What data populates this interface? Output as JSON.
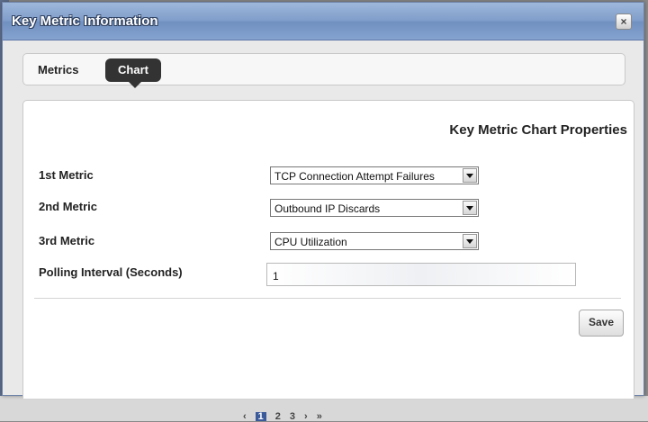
{
  "dialog": {
    "title": "Key Metric Information",
    "close_label": "×"
  },
  "tabs": [
    {
      "label": "Metrics",
      "active": false
    },
    {
      "label": "Chart",
      "active": true
    }
  ],
  "panel": {
    "heading": "Key Metric Chart Properties",
    "fields": {
      "metric1": {
        "label": "1st Metric",
        "value": "TCP Connection Attempt Failures"
      },
      "metric2": {
        "label": "2nd Metric",
        "value": "Outbound IP Discards"
      },
      "metric3": {
        "label": "3rd Metric",
        "value": "CPU Utilization"
      },
      "polling": {
        "label": "Polling Interval (Seconds)",
        "value": "1"
      }
    },
    "save_label": "Save"
  },
  "pager": {
    "current_page": "1",
    "pages": [
      "2",
      "3"
    ],
    "prev_icon": "chevron-left-icon",
    "next_icon": "chevron-right-icon",
    "last_icon": "last-page-icon"
  },
  "colors": {
    "titlebar": "#7f9cc9",
    "active_tab": "#333333",
    "panel_bg": "#ffffff"
  }
}
